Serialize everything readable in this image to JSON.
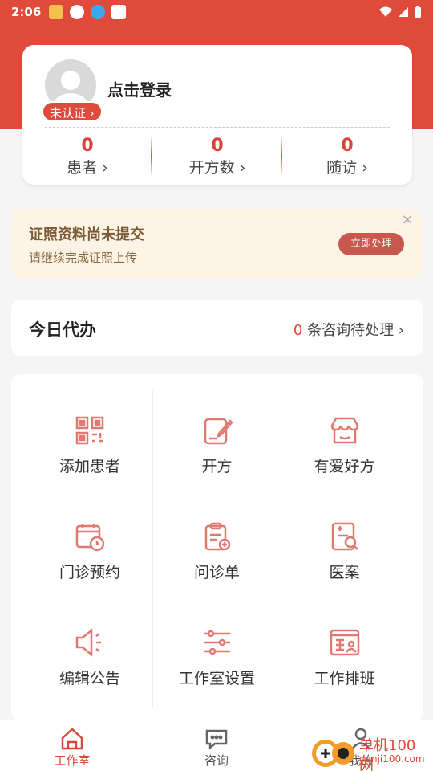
{
  "status_bar": {
    "time": "2:06"
  },
  "profile": {
    "login_text": "点击登录",
    "verify_badge": "未认证 ›",
    "stats": [
      {
        "value": "0",
        "label": "患者 ›"
      },
      {
        "value": "0",
        "label": "开方数 ›"
      },
      {
        "value": "0",
        "label": "随访 ›"
      }
    ]
  },
  "notice": {
    "title": "证照资料尚未提交",
    "subtitle": "请继续完成证照上传",
    "action": "立即处理",
    "close": "×"
  },
  "todo": {
    "title": "今日代办",
    "count": "0",
    "suffix": " 条咨询待处理 ›"
  },
  "grid": [
    {
      "label": "添加患者",
      "icon": "qr-code-icon"
    },
    {
      "label": "开方",
      "icon": "prescription-pen-icon"
    },
    {
      "label": "有爱好方",
      "icon": "store-icon"
    },
    {
      "label": "门诊预约",
      "icon": "calendar-clock-icon"
    },
    {
      "label": "问诊单",
      "icon": "clipboard-plus-icon"
    },
    {
      "label": "医案",
      "icon": "medical-record-search-icon"
    },
    {
      "label": "编辑公告",
      "icon": "megaphone-icon"
    },
    {
      "label": "工作室设置",
      "icon": "sliders-icon"
    },
    {
      "label": "工作排班",
      "icon": "schedule-board-icon"
    }
  ],
  "tabbar": [
    {
      "label": "工作室",
      "icon": "home-icon",
      "active": true
    },
    {
      "label": "咨询",
      "icon": "chat-icon",
      "active": false
    },
    {
      "label": "我的",
      "icon": "user-icon",
      "active": false
    }
  ],
  "watermark": {
    "text": "单机100网",
    "url": "danji100.com"
  },
  "colors": {
    "primary": "#e04a3b",
    "icon": "#e07a70",
    "notice_bg": "#fdf4e6"
  }
}
